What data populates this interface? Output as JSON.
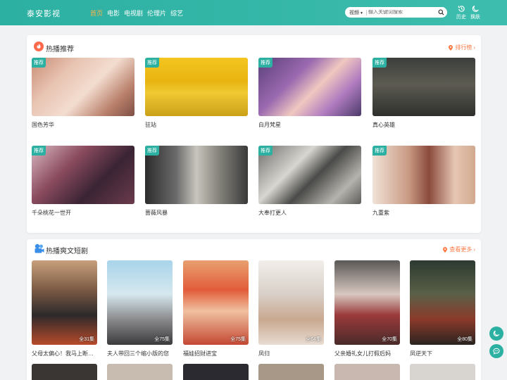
{
  "site": {
    "logo": "泰安影视"
  },
  "nav": [
    "首页",
    "电影",
    "电视剧",
    "伦理片",
    "综艺"
  ],
  "search": {
    "category": "视频",
    "placeholder": "输入关键词搜索"
  },
  "header_buttons": {
    "history": "历史",
    "skin": "换肤"
  },
  "colors": {
    "accent": "#2cb0a2",
    "active_nav": "#ffb24a",
    "more_link": "#ff7a45"
  },
  "hot": {
    "title": "热播推荐",
    "more": "排行榜",
    "tag": "推荐",
    "items": [
      {
        "title": "国色芳华"
      },
      {
        "title": "驻站"
      },
      {
        "title": "白月梵星"
      },
      {
        "title": "真心英雄"
      },
      {
        "title": "千朵桃花一世开"
      },
      {
        "title": "蔷薇风暴"
      },
      {
        "title": "大奉打更人"
      },
      {
        "title": "九重紫"
      }
    ]
  },
  "short": {
    "title": "热播爽文短剧",
    "more": "查看更多",
    "items": [
      {
        "title": "父母太偏心！我马上断亲爆身份",
        "episodes": "全31集"
      },
      {
        "title": "夫人带回三个缩小版的您",
        "episodes": "全75集"
      },
      {
        "title": "福娃招财进宝",
        "episodes": "全75集"
      },
      {
        "title": "凤归",
        "episodes": "全64集"
      },
      {
        "title": "父亲婚礼女儿打假后妈",
        "episodes": "全70集"
      },
      {
        "title": "凤逆天下",
        "episodes": "全80集"
      }
    ]
  }
}
